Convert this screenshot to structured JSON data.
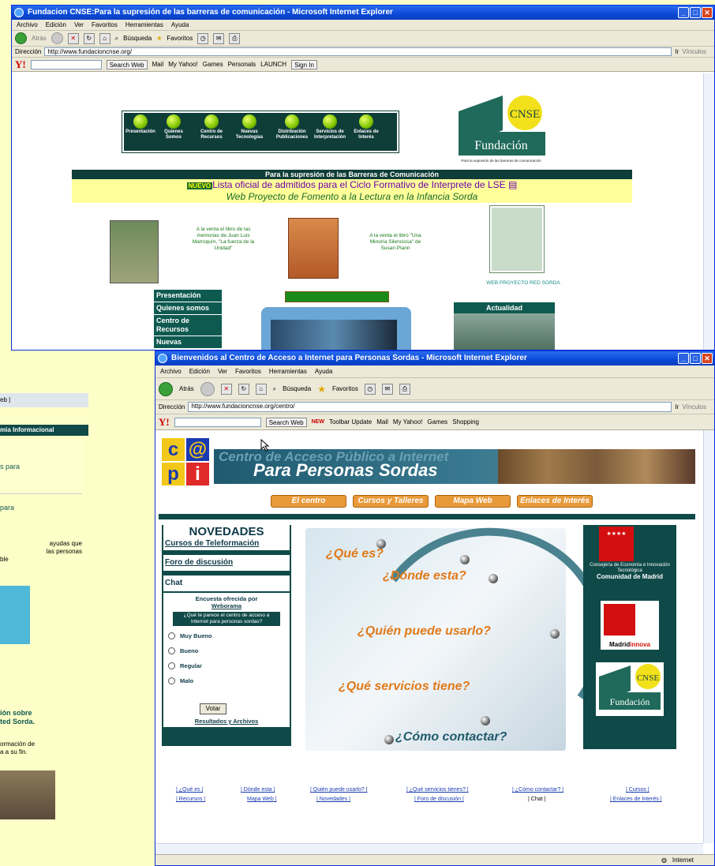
{
  "win1": {
    "title": "Fundacion CNSE:Para la supresión de las barreras de comunicación - Microsoft Internet Explorer",
    "menu": [
      "Archivo",
      "Edición",
      "Ver",
      "Favoritos",
      "Herramientas",
      "Ayuda"
    ],
    "back": "Atrás",
    "search": "Búsqueda",
    "favorites": "Favoritos",
    "address_label": "Dirección",
    "url": "http://www.fundacioncnse.org/",
    "go": "Ir",
    "links": "Vínculos",
    "ybar": {
      "search_web": "Search Web",
      "mail": "Mail",
      "myyahoo": "My Yahoo!",
      "games": "Games",
      "personals": "Personals",
      "launch": "LAUNCH",
      "signin": "Sign In"
    },
    "nav": [
      {
        "label": "Presentación"
      },
      {
        "label": "Quienes Somos"
      },
      {
        "label": "Centro de Recursos"
      },
      {
        "label": "Nuevas Tecnologías"
      },
      {
        "label": "Distribución Publicaciones"
      },
      {
        "label": "Servicios de Interpretación"
      },
      {
        "label": "Enlaces de Interés"
      }
    ],
    "logo": {
      "cnse": "CNSE",
      "fundacion": "Fundación",
      "tag": "Para la supresión de las barreras de comunicación"
    },
    "band_title": "Para la supresión de las Barreras de Comunicación",
    "nuevo": "NUEVO",
    "news1": "Lista oficial de admitidos para el Ciclo Formativo de Interprete de LSE",
    "news2": "Web Proyecto de Fomento a la Lectura en la Infancia Sorda",
    "blurb1": "A la venta el libro de las memorias de Juan Luis Marroquín, \"La fuerza de la Unidad\"",
    "blurb2": "A la venta el libro \"Una Minoría Silenciosa\" de Susan Plann",
    "blurb3": "WEB PROYECTO RED SORDA",
    "leftnav": [
      "Presentación",
      "Quienes somos",
      "Centro de Recursos",
      "Nuevas"
    ],
    "actualidad": "Actualidad"
  },
  "win2": {
    "title": "Bienvenidos al Centro de Acceso a Internet para Personas Sordas - Microsoft Internet Explorer",
    "menu": [
      "Archivo",
      "Edición",
      "Ver",
      "Favoritos",
      "Herramientas",
      "Ayuda"
    ],
    "back": "Atrás",
    "search": "Búsqueda",
    "favorites": "Favoritos",
    "address_label": "Dirección",
    "url": "http://www.fundacioncnse.org/centro/",
    "go": "Ir",
    "links": "Vínculos",
    "ybar": {
      "search_web": "Search Web",
      "new": "NEW",
      "toolbar_update": "Toolbar Update",
      "mail": "Mail",
      "myyahoo": "My Yahoo!",
      "games": "Games",
      "shopping": "Shopping"
    },
    "header": {
      "ghost": "Centro de Acceso Público a Internet",
      "main": "Para Personas Sordas"
    },
    "tabs": [
      "El centro",
      "Cursos y Talleres",
      "Mapa Web",
      "Enlaces de Interés"
    ],
    "novedades": "NOVEDADES",
    "links_left": [
      "Cursos de Teleformación",
      "Foro de discusión",
      "Chat"
    ],
    "poll": {
      "title": "Encuesta ofrecida por",
      "brand": "Weborama",
      "question": "¿Qué te parece el centro de acceso a Internet para personas sordas?",
      "options": [
        "Muy Bueno",
        "Bueno",
        "Regular",
        "Malo"
      ],
      "vote": "Votar",
      "results": "Resultados y Archivos"
    },
    "questions": [
      "¿Qué es?",
      "¿Dónde esta?",
      "¿Quién puede usarlo?",
      "¿Qué servicios tiene?",
      "¿Cómo contactar?"
    ],
    "right": {
      "org1": "Consejería de Economía e Innovación Tecnológica",
      "org2": "Comunidad de Madrid",
      "madrid": "Madrid",
      "innova": "innova",
      "cnse": "CNSE",
      "fundacion": "Fundación"
    },
    "footer": [
      "| ¿Qué es |",
      "| Dónde esta |",
      "| Quién puede usarlo? |",
      "| ¿Qué servicios tienes? |",
      "| ¿Cómo contactar? |",
      "| Cursos |",
      "| Recursos |",
      "Mapa Web |",
      "| Novedades |",
      "| Foro de discusión |",
      "| Chat |",
      "| Enlaces de Interés |"
    ],
    "status": "Internet"
  },
  "win3": {
    "frag": [
      "eb |",
      "mia Informacional",
      "s para",
      "para",
      "ayudas que",
      "las personas",
      "ble",
      "ión sobre",
      "ted Sorda.",
      "ormación de",
      "a a su fin."
    ]
  },
  "colors": {
    "accent": "#0f4a48",
    "xp_blue": "#0a49d6",
    "orange": "#e89a3a",
    "bg": "#fefec8"
  }
}
